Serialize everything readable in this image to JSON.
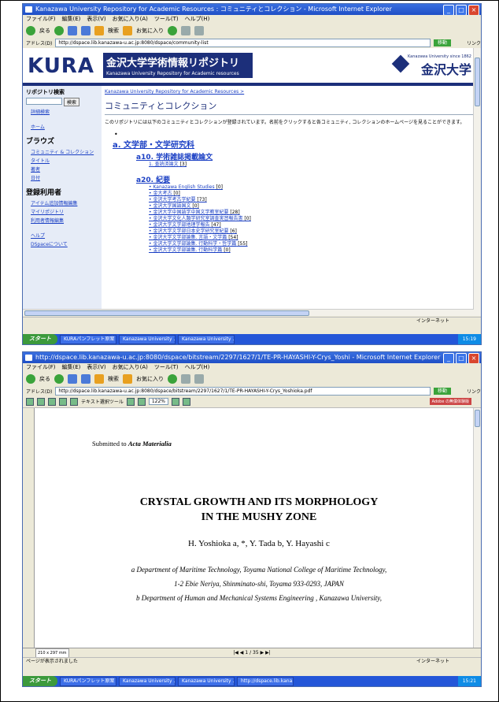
{
  "shot1": {
    "window_title": "Kanazawa University Repository for Academic Resources : コミュニティとコレクション - Microsoft Internet Explorer",
    "menu": [
      "ファイル(F)",
      "編集(E)",
      "表示(V)",
      "お気に入り(A)",
      "ツール(T)",
      "ヘルプ(H)"
    ],
    "toolbar": {
      "back": "戻る",
      "search": "検索",
      "favorites": "お気に入り"
    },
    "address_label": "アドレス(D)",
    "address": "http://dspace.lib.kanazawa-u.ac.jp:8080/dspace/community-list",
    "go_label": "移動",
    "links_label": "リンク",
    "logo": "KURA",
    "site_title_jp": "金沢大学学術情報リポジトリ",
    "site_title_en": "Kanazawa University Repository for Academic resources",
    "university_small": "Kanazawa University since 1862",
    "university_big": "金沢大学",
    "sidebar": {
      "search_head": "リポジトリ検索",
      "search_button": "検索",
      "advanced": "詳細検索",
      "home": "ホーム",
      "browse_head": "ブラウズ",
      "browse_items": [
        "コミュニティ & コレクション",
        "タイトル",
        "著者",
        "日付"
      ],
      "registered_head": "登録利用者",
      "registered_items": [
        "アイテム追加情報編集",
        "マイリポジトリ",
        "利用者情報編集"
      ],
      "other_items": [
        "ヘルプ",
        "DSpaceについて"
      ]
    },
    "breadcrumb": "Kanazawa University Repository for Academic Resources >",
    "content_title": "コミュニティとコレクション",
    "intro": "このリポジトリには以下のコミュニティとコレクションが登録されています。名前をクリックすると各コミュニティ, コレクションのホームページを見ることができます。",
    "community": "a. 文学部・文学研究科",
    "sub1": "a10. 学術雑誌掲載論文",
    "sub1_items": [
      {
        "label": "1. 査読済論文",
        "count": "[3]"
      }
    ],
    "sub2": "a20. 紀要",
    "sub2_items": [
      {
        "label": "Kanazawa English Studies",
        "count": "[0]"
      },
      {
        "label": "金大考古",
        "count": "[0]"
      },
      {
        "label": "金沢大学考古学紀要",
        "count": "[73]"
      },
      {
        "label": "金沢大学国語国文",
        "count": "[0]"
      },
      {
        "label": "金沢大学中国語学中国文学教室紀要",
        "count": "[28]"
      },
      {
        "label": "金沢大学文化人類学研究室調査実習報告書",
        "count": "[0]"
      },
      {
        "label": "金沢大学文学部地理学報告",
        "count": "[47]"
      },
      {
        "label": "金沢大学文学部日本史学研究室紀要",
        "count": "[6]"
      },
      {
        "label": "金沢大学文学部論集. 言語・文学篇",
        "count": "[54]"
      },
      {
        "label": "金沢大学文学部論集. 行動科学・哲学篇",
        "count": "[55]"
      },
      {
        "label": "金沢大学文学部論集. 行動科学篇",
        "count": "[0]"
      }
    ],
    "status": "インターネット",
    "taskbar": {
      "start": "スタート",
      "items": [
        "KURAパンフレット原案",
        "Kanazawa University ...",
        "Kanazawa University ..."
      ],
      "clock": "15:19"
    }
  },
  "shot2": {
    "window_title": "http://dspace.lib.kanazawa-u.ac.jp:8080/dspace/bitstream/2297/1627/1/TE-PR-HAYASHI-Y-Crys_Yoshi - Microsoft Internet Explorer",
    "menu": [
      "ファイル(F)",
      "編集(E)",
      "表示(V)",
      "お気に入り(A)",
      "ツール(T)",
      "ヘルプ(H)"
    ],
    "toolbar": {
      "back": "戻る",
      "search": "検索",
      "favorites": "お気に入り"
    },
    "address_label": "アドレス(D)",
    "address": "http://dspace.lib.kanazawa-u.ac.jp:8080/dspace/bitstream/2297/1627/1/TE-PR-HAYASHI-Y-Crys_Yoshioka.pdf",
    "go_label": "移動",
    "links_label": "リンク",
    "pdf_toolbar": {
      "select_text": "テキスト選択ツール",
      "zoom": "122%",
      "adobe": "Adobe の無償体験版"
    },
    "submitted": "Submitted to ",
    "journal": "Acta Materialia",
    "title_line1": "CRYSTAL GROWTH AND ITS MORPHOLOGY",
    "title_line2": "IN THE MUSHY ZONE",
    "authors": "H. Yoshioka a, *, Y. Tada b, Y. Hayashi c",
    "aff_a_1": "a Department of Maritime Technology, Toyama National College of Maritime Technology,",
    "aff_a_2": "1-2 Ebie Neriya, Shinminato-shi, Toyama 933-0293, JAPAN",
    "aff_b_1": "b Department of Human and Mechanical Systems Engineering , Kanazawa University,",
    "page_size": "210 x 297 mm",
    "page_counter": "1 / 35",
    "status": "ページが表示されました",
    "status_zone": "インターネット",
    "taskbar": {
      "start": "スタート",
      "items": [
        "KURAパンフレット原案",
        "Kanazawa University ...",
        "Kanazawa University ...",
        "http://dspace.lib.kana..."
      ],
      "clock": "15:21"
    }
  }
}
